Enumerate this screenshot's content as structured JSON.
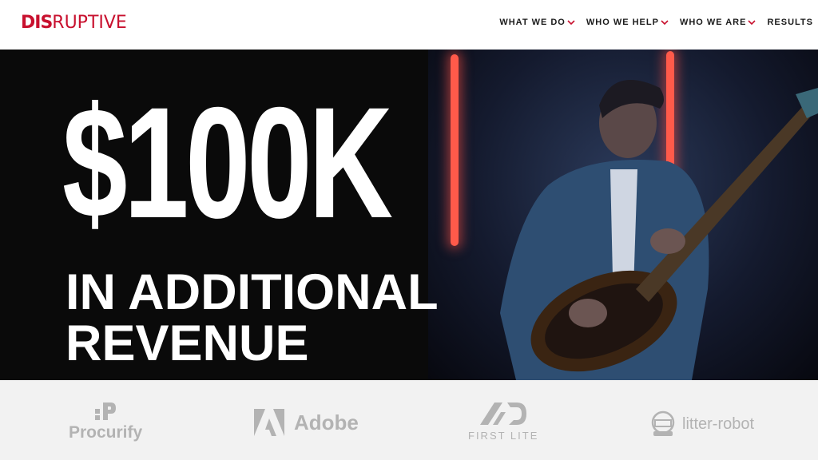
{
  "header": {
    "logo": {
      "strong": "DIS",
      "light": "RUPTIVE"
    },
    "nav": [
      {
        "label": "WHAT WE DO",
        "dropdown": true
      },
      {
        "label": "WHO WE HELP",
        "dropdown": true
      },
      {
        "label": "WHO WE ARE",
        "dropdown": true
      },
      {
        "label": "RESULTS",
        "dropdown": false
      }
    ]
  },
  "hero": {
    "headline": "$100K",
    "subline1": "IN ADDITIONAL",
    "subline2": "REVENUE",
    "image": "guitarist-playing-electric-guitar-neon-lights"
  },
  "clients": [
    {
      "name": "Procurify",
      "icon": "procurify-logo-icon"
    },
    {
      "name": "Adobe",
      "icon": "adobe-logo-icon"
    },
    {
      "name": "FIRST LITE",
      "icon": "first-lite-logo-icon"
    },
    {
      "name": "litter-robot",
      "icon": "litter-robot-logo-icon"
    }
  ],
  "colors": {
    "brand_red": "#c8102e",
    "hero_bg": "#0a0a0a",
    "logo_strip_bg": "#f2f2f2",
    "client_logo_gray": "#b3b3b3"
  }
}
